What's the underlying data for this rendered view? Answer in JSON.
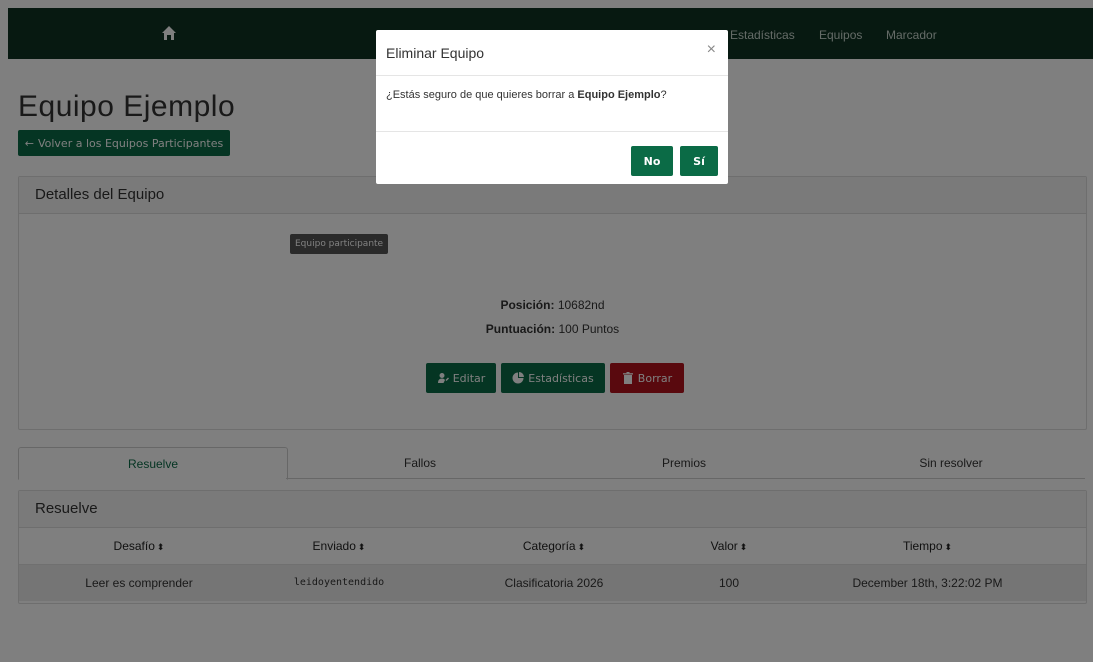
{
  "nav": {
    "home_icon": "home-icon",
    "links": [
      "Estadísticas",
      "Equipos",
      "Marcador"
    ]
  },
  "page": {
    "title": "Equipo Ejemplo",
    "back_arrow": "←",
    "back_label": "Volver a los Equipos Participantes"
  },
  "details": {
    "heading": "Detalles del Equipo",
    "tag": "Equipo participante",
    "position_label": "Posición:",
    "position_value": "10682nd",
    "score_label": "Puntuación:",
    "score_value": "100 Puntos",
    "edit_label": "Editar",
    "stats_label": "Estadísticas",
    "delete_label": "Borrar"
  },
  "tabs": [
    "Resuelve",
    "Fallos",
    "Premios",
    "Sin resolver"
  ],
  "solves": {
    "heading": "Resuelve",
    "sort_glyph": "⬍",
    "columns": [
      "Desafío",
      "Enviado",
      "Categoría",
      "Valor",
      "Tiempo"
    ],
    "rows": [
      [
        "Leer es comprender",
        "leidoyentendido",
        "Clasificatoria 2026",
        "100",
        "December 18th, 3:22:02 PM"
      ]
    ]
  },
  "modal": {
    "title": "Eliminar Equipo",
    "close": "×",
    "body_prefix": "¿Estás seguro de que quieres borrar a",
    "body_team": "Equipo Ejemplo",
    "body_suffix": "?",
    "no_label": "No",
    "yes_label": "Sí"
  },
  "colors": {
    "navbar": "#0f3322",
    "primary": "#0b6b46",
    "danger": "#b3121c",
    "overlay": "rgba(0,0,0,0.5)"
  }
}
